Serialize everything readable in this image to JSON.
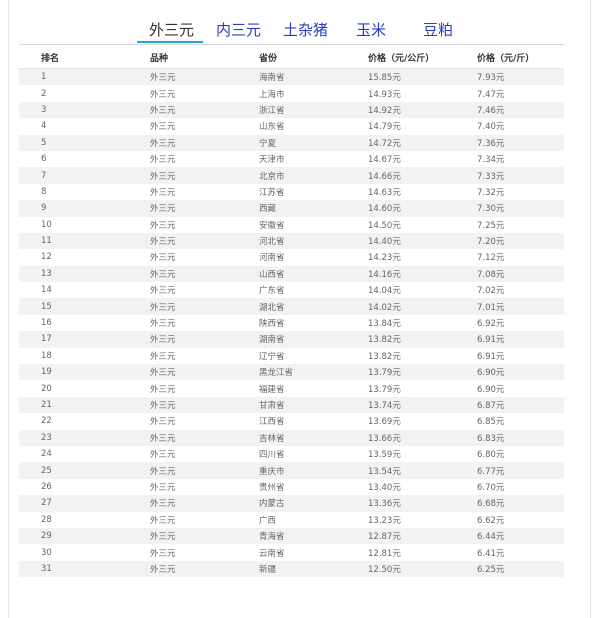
{
  "tabs": [
    {
      "label": "外三元",
      "active": true
    },
    {
      "label": "内三元",
      "active": false
    },
    {
      "label": "土杂猪",
      "active": false
    },
    {
      "label": "玉米",
      "active": false
    },
    {
      "label": "豆粕",
      "active": false
    }
  ],
  "table": {
    "headers": [
      "排名",
      "品种",
      "省份",
      "价格（元/公斤）",
      "价格（元/斤）"
    ],
    "rows": [
      [
        "1",
        "外三元",
        "海南省",
        "15.85元",
        "7.93元"
      ],
      [
        "2",
        "外三元",
        "上海市",
        "14.93元",
        "7.47元"
      ],
      [
        "3",
        "外三元",
        "浙江省",
        "14.92元",
        "7.46元"
      ],
      [
        "4",
        "外三元",
        "山东省",
        "14.79元",
        "7.40元"
      ],
      [
        "5",
        "外三元",
        "宁夏",
        "14.72元",
        "7.36元"
      ],
      [
        "6",
        "外三元",
        "天津市",
        "14.67元",
        "7.34元"
      ],
      [
        "7",
        "外三元",
        "北京市",
        "14.66元",
        "7.33元"
      ],
      [
        "8",
        "外三元",
        "江苏省",
        "14.63元",
        "7.32元"
      ],
      [
        "9",
        "外三元",
        "西藏",
        "14.60元",
        "7.30元"
      ],
      [
        "10",
        "外三元",
        "安徽省",
        "14.50元",
        "7.25元"
      ],
      [
        "11",
        "外三元",
        "河北省",
        "14.40元",
        "7.20元"
      ],
      [
        "12",
        "外三元",
        "河南省",
        "14.23元",
        "7.12元"
      ],
      [
        "13",
        "外三元",
        "山西省",
        "14.16元",
        "7.08元"
      ],
      [
        "14",
        "外三元",
        "广东省",
        "14.04元",
        "7.02元"
      ],
      [
        "15",
        "外三元",
        "湖北省",
        "14.02元",
        "7.01元"
      ],
      [
        "16",
        "外三元",
        "陕西省",
        "13.84元",
        "6.92元"
      ],
      [
        "17",
        "外三元",
        "湖南省",
        "13.82元",
        "6.91元"
      ],
      [
        "18",
        "外三元",
        "辽宁省",
        "13.82元",
        "6.91元"
      ],
      [
        "19",
        "外三元",
        "黑龙江省",
        "13.79元",
        "6.90元"
      ],
      [
        "20",
        "外三元",
        "福建省",
        "13.79元",
        "6.90元"
      ],
      [
        "21",
        "外三元",
        "甘肃省",
        "13.74元",
        "6.87元"
      ],
      [
        "22",
        "外三元",
        "江西省",
        "13.69元",
        "6.85元"
      ],
      [
        "23",
        "外三元",
        "吉林省",
        "13.66元",
        "6.83元"
      ],
      [
        "24",
        "外三元",
        "四川省",
        "13.59元",
        "6.80元"
      ],
      [
        "25",
        "外三元",
        "重庆市",
        "13.54元",
        "6.77元"
      ],
      [
        "26",
        "外三元",
        "贵州省",
        "13.40元",
        "6.70元"
      ],
      [
        "27",
        "外三元",
        "内蒙古",
        "13.36元",
        "6.68元"
      ],
      [
        "28",
        "外三元",
        "广西",
        "13.23元",
        "6.62元"
      ],
      [
        "29",
        "外三元",
        "青海省",
        "12.87元",
        "6.44元"
      ],
      [
        "30",
        "外三元",
        "云南省",
        "12.81元",
        "6.41元"
      ],
      [
        "31",
        "外三元",
        "新疆",
        "12.50元",
        "6.25元"
      ]
    ]
  },
  "colors": {
    "tab_link": "#2b3cc4",
    "tab_active": "#333333",
    "tab_underline": "#2aa0e0",
    "row_stripe": "#f2f2f2"
  }
}
